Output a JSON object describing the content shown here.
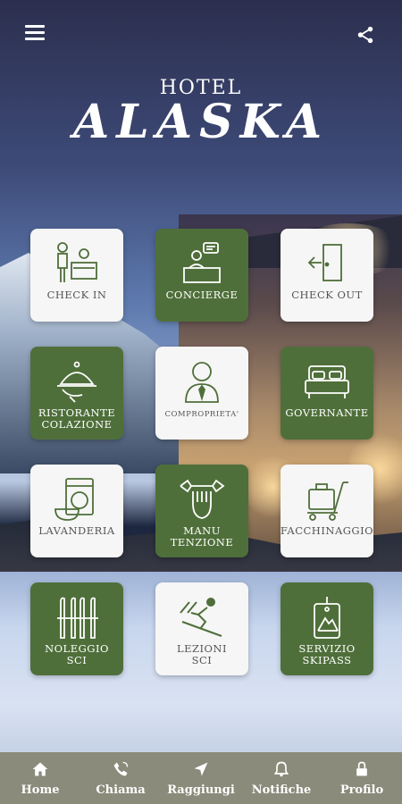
{
  "header": {
    "menu_icon": "hamburger-menu-icon",
    "share_icon": "share-icon",
    "brand_small": "HOTEL",
    "brand_large": "ALASKA"
  },
  "colors": {
    "tile_green": "#4f6f3a",
    "tile_light": "#f6f6f6",
    "nav_bg": "#8a8b7a"
  },
  "tiles": [
    {
      "label": "CHECK IN",
      "icon": "reception-desk-icon",
      "style": "light"
    },
    {
      "label": "CONCIERGE",
      "icon": "concierge-desk-icon",
      "style": "green"
    },
    {
      "label": "CHECK OUT",
      "icon": "exit-door-icon",
      "style": "light"
    },
    {
      "label": "RISTORANTE\nCOLAZIONE",
      "icon": "cloche-serving-icon",
      "style": "green"
    },
    {
      "label": "COMPROPRIETA'",
      "icon": "business-person-icon",
      "style": "light"
    },
    {
      "label": "GOVERNANTE",
      "icon": "bed-icon",
      "style": "green"
    },
    {
      "label": "LAVANDERIA",
      "icon": "washing-machine-icon",
      "style": "light"
    },
    {
      "label": "MANU\nTENZIONE",
      "icon": "wrench-hand-icon",
      "style": "green"
    },
    {
      "label": "FACCHINAGGIO",
      "icon": "luggage-cart-icon",
      "style": "light"
    },
    {
      "label": "NOLEGGIO\nSCI",
      "icon": "skis-icon",
      "style": "green"
    },
    {
      "label": "LEZIONI\nSCI",
      "icon": "skier-icon",
      "style": "light"
    },
    {
      "label": "SERVIZIO\nSKIPASS",
      "icon": "ski-pass-icon",
      "style": "green"
    }
  ],
  "nav": [
    {
      "label": "Home",
      "icon": "home-icon"
    },
    {
      "label": "Chiama",
      "icon": "phone-icon"
    },
    {
      "label": "Raggiungi",
      "icon": "navigation-arrow-icon"
    },
    {
      "label": "Notifiche",
      "icon": "bell-icon"
    },
    {
      "label": "Profilo",
      "icon": "lock-icon"
    }
  ]
}
